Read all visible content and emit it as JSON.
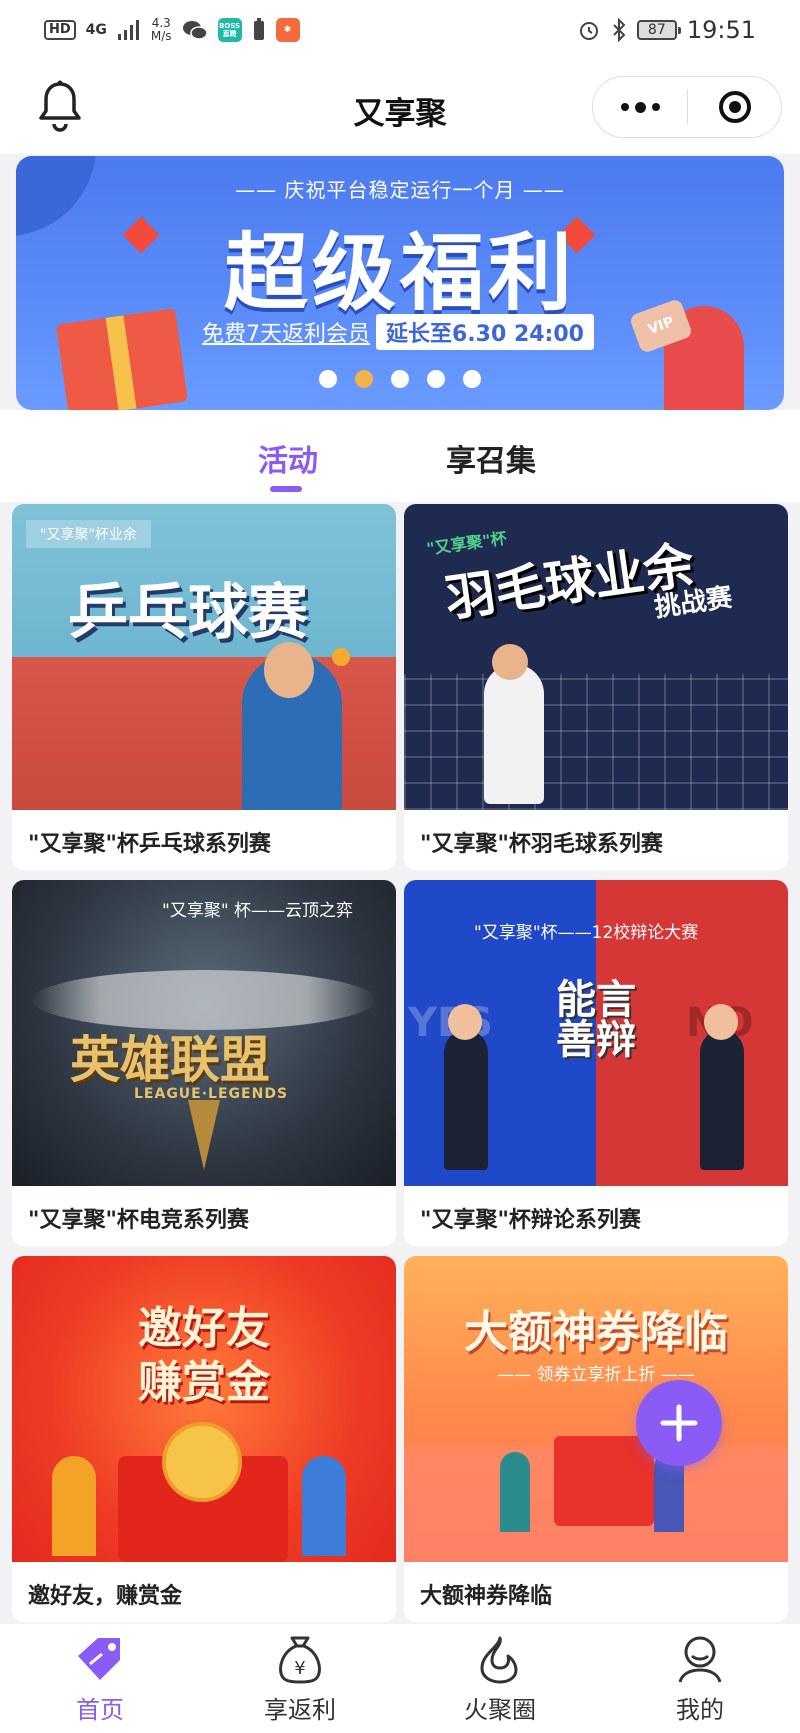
{
  "status_bar": {
    "hd": "HD",
    "net": "4G",
    "speed_value": "4.3",
    "speed_unit": "M/s",
    "boss_label": "BOSS\n直聘",
    "battery": "87",
    "time": "19:51"
  },
  "header": {
    "title": "又享聚"
  },
  "banner": {
    "subtitle": "—— 庆祝平台稳定运行一个月 ——",
    "title": "超级福利",
    "offer": "免费7天返利会员",
    "extend": "延长至6.30 24:00",
    "vip": "VIP",
    "dot_count": 5,
    "active_dot": 2
  },
  "tabs": {
    "active": "活动",
    "inactive": "享召集"
  },
  "cards": [
    {
      "title": "\"又享聚\"杯乒乓球系列赛",
      "tag": "\"又享聚\"杯业余",
      "headline": "乒乓球赛"
    },
    {
      "title": "\"又享聚\"杯羽毛球系列赛",
      "tag": "\"又享聚\"杯",
      "headline": "羽毛球业余",
      "sub": "挑战赛"
    },
    {
      "title": "\"又享聚\"杯电竞系列赛",
      "tag": "\"又享聚\" 杯——云顶之弈",
      "headline": "英雄联盟",
      "sub": "LEAGUE·LEGENDS"
    },
    {
      "title": "\"又享聚\"杯辩论系列赛",
      "tag": "\"又享聚\"杯——12校辩论大赛",
      "headline": "能言善辩",
      "yes": "YES",
      "no": "NO"
    },
    {
      "title": "邀好友，赚赏金",
      "headline": "邀好友",
      "sub": "赚赏金"
    },
    {
      "title": "大额神券降临",
      "headline": "大额神券降临",
      "sub": "—— 领券立享折上折 ——"
    }
  ],
  "tabbar": [
    {
      "label": "首页",
      "active": true
    },
    {
      "label": "享返利",
      "active": false
    },
    {
      "label": "火聚圈",
      "active": false
    },
    {
      "label": "我的",
      "active": false
    }
  ],
  "colors": {
    "accent": "#8a5cf5",
    "banner_blue": "#5a8af7"
  }
}
